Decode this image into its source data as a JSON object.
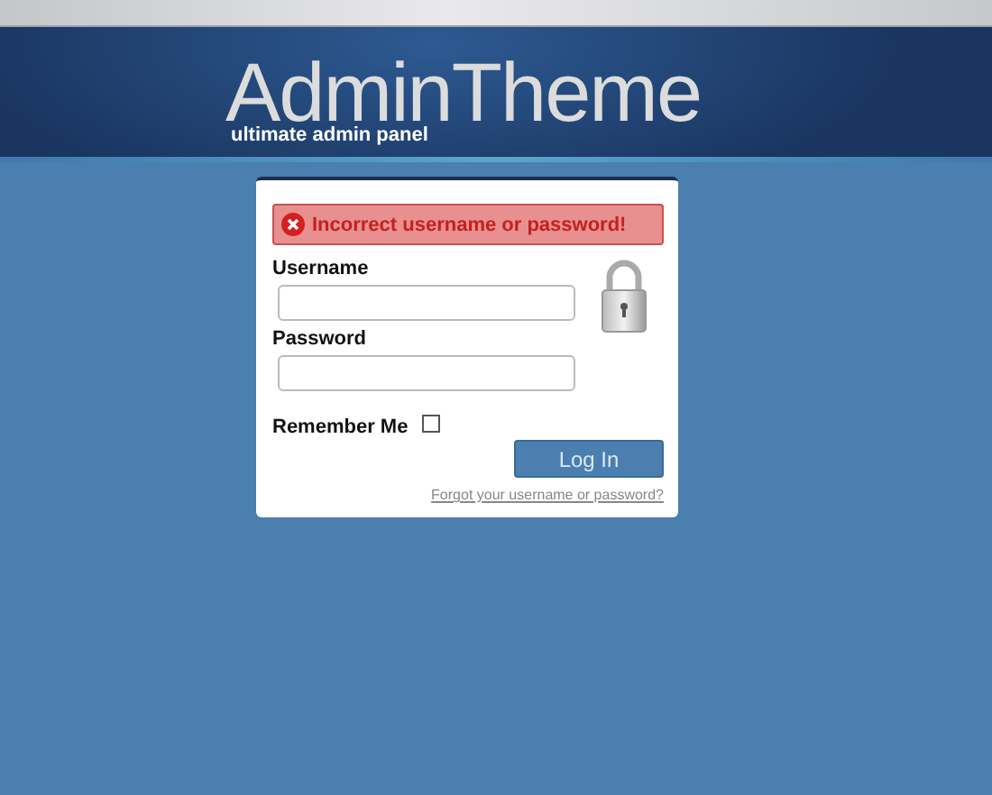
{
  "header": {
    "logo": "AdminTheme",
    "tagline": "ultimate admin panel"
  },
  "login": {
    "error": "Incorrect username or password!",
    "fields": [
      {
        "label": "Username"
      },
      {
        "label": "Password"
      }
    ],
    "remember": {
      "label": "Remember Me",
      "checked": false
    },
    "submit": "Log In",
    "forgot_link": "Forgot your username or password?"
  }
}
